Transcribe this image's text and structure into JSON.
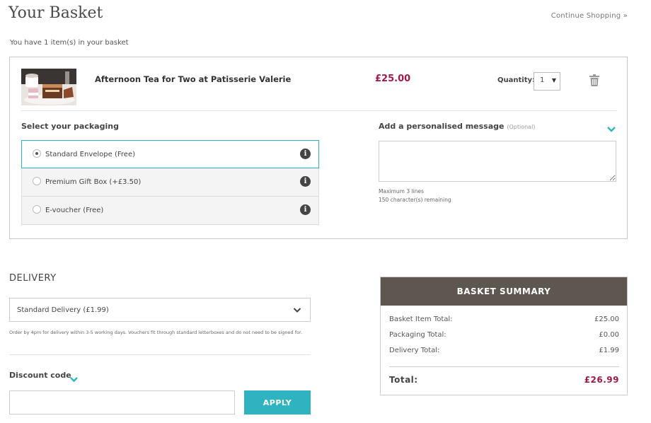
{
  "header": {
    "title": "Your Basket",
    "continue_link": "Continue Shopping »",
    "item_count": "You have 1 item(s) in your basket"
  },
  "item": {
    "name": "Afternoon Tea for Two at Patisserie Valerie",
    "price": "£25.00",
    "quantity_label": "Quantity:",
    "quantity_value": "1",
    "image": "afternoon-tea-cake-photo"
  },
  "packaging": {
    "label": "Select your packaging",
    "options": [
      {
        "label": "Standard Envelope (Free)",
        "selected": true
      },
      {
        "label": "Premium Gift Box (+£3.50)",
        "selected": false
      },
      {
        "label": "E-voucher (Free)",
        "selected": false
      }
    ],
    "info_icon": "info-icon"
  },
  "message": {
    "label": "Add a personalised message",
    "optional": "(Optional)",
    "hint_lines": "Maximum 3 lines",
    "hint_chars": "150 character(s) remaining"
  },
  "delivery": {
    "title": "DELIVERY",
    "selected": "Standard Delivery (£1.99)",
    "note": "Order by 4pm for delivery within 3-5 working days. Vouchers fit through standard letterboxes and do not need to be signed for."
  },
  "discount": {
    "label": "Discount code",
    "apply": "APPLY"
  },
  "summary": {
    "title": "BASKET SUMMARY",
    "rows": [
      {
        "label": "Basket Item Total:",
        "value": "£25.00"
      },
      {
        "label": "Packaging Total:",
        "value": "£0.00"
      },
      {
        "label": "Delivery Total:",
        "value": "£1.99"
      }
    ],
    "total_label": "Total:",
    "total_value": "£26.99"
  },
  "colors": {
    "accent": "#2eb3c0",
    "price": "#a21947",
    "summary_header": "#5e5750"
  }
}
